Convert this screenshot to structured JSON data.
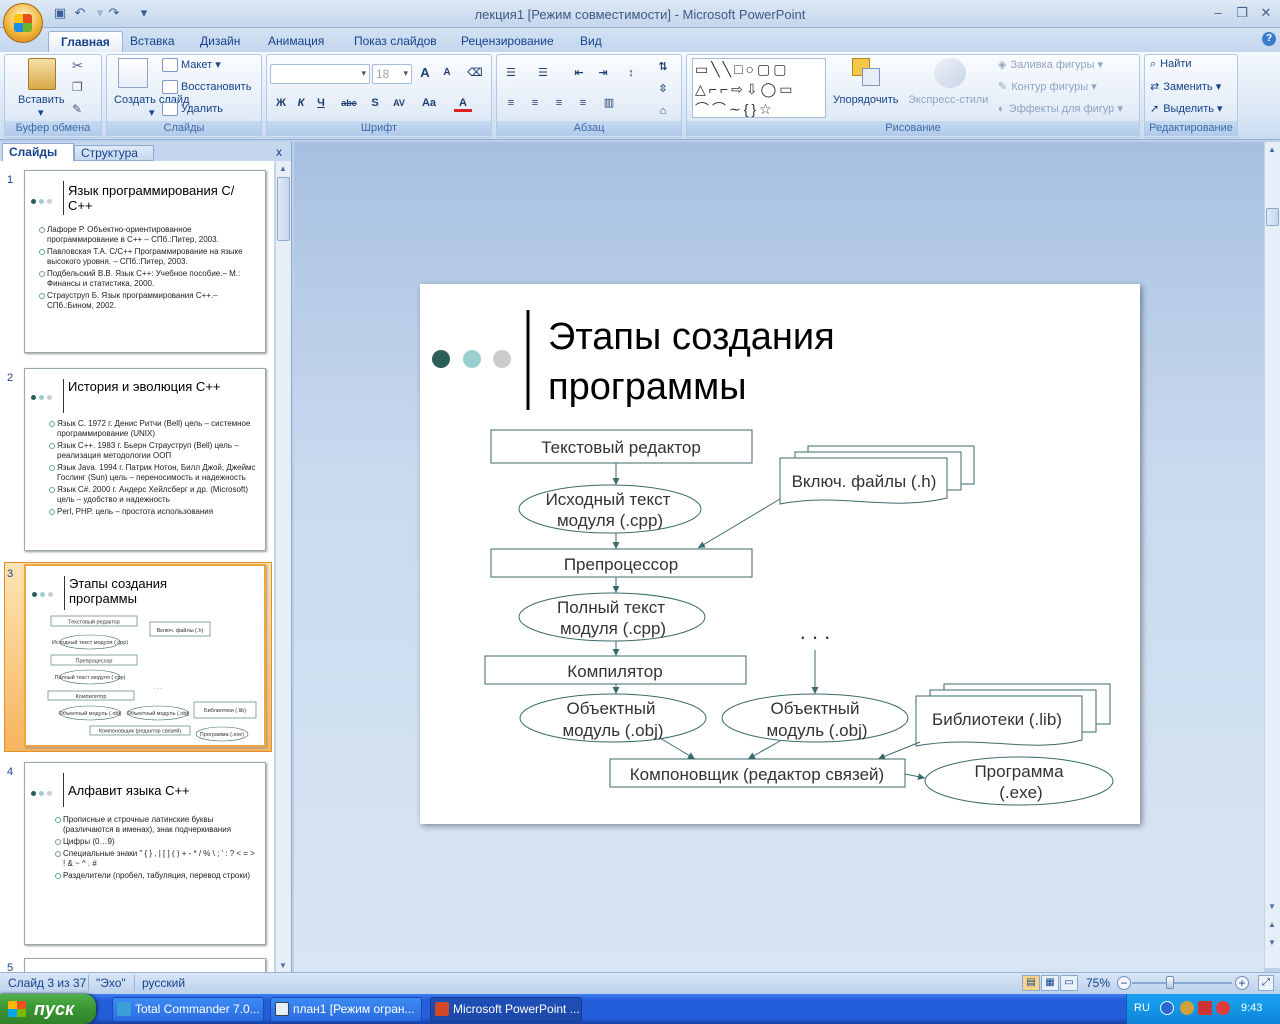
{
  "window": {
    "title": "лекция1 [Режим совместимости] - Microsoft PowerPoint",
    "minimize": "–",
    "maximize": "❐",
    "close": "✕"
  },
  "ribbon": {
    "tabs": [
      "Главная",
      "Вставка",
      "Дизайн",
      "Анимация",
      "Показ слайдов",
      "Рецензирование",
      "Вид"
    ],
    "active_tab": "Главная",
    "clipboard": {
      "paste": "Вставить",
      "label": "Буфер обмена"
    },
    "slides": {
      "new_slide": "Создать слайд",
      "new_slide_arrow": "▾",
      "layout": "Макет",
      "reset": "Восстановить",
      "delete": "Удалить",
      "label": "Слайды"
    },
    "font": {
      "font_name": "",
      "font_size": "18",
      "label": "Шрифт"
    },
    "paragraph": {
      "label": "Абзац"
    },
    "drawing": {
      "arrange": "Упорядочить",
      "quick_styles": "Экспресс-стили",
      "shape_fill": "Заливка фигуры",
      "shape_outline": "Контур фигуры",
      "shape_effects": "Эффекты для фигур",
      "label": "Рисование"
    },
    "editing": {
      "find": "Найти",
      "replace": "Заменить",
      "select": "Выделить",
      "label": "Редактирование"
    }
  },
  "left_pane": {
    "tab_slides": "Слайды",
    "tab_outline": "Структура",
    "close": "x",
    "slides": [
      {
        "num": "1",
        "title": "Язык программирования С/С++",
        "bullets": [
          "Лафоре Р. Объектно-ориентированное программирование в С++ – СПб.:Питер, 2003.",
          "Павловская Т.А. С/С++ Программирование на языке высокого уровня. – СПб.:Питер, 2003.",
          "Подбельский В.В. Язык С++: Учебное пособие.– М.: Финансы и статистика, 2000.",
          "Страуструп Б. Язык программирования С++.– СПб.:Бином, 2002."
        ]
      },
      {
        "num": "2",
        "title": "История и эволюция С++",
        "bullets": [
          "Язык С. 1972 г. Денис Ритчи (Bell) цель – системное программирование (UNIX)",
          "Язык С++. 1983 г. Бьерн Страуструп (Bell) цель – реализация методологии ООП",
          "Язык Java. 1994 г. Патрик Нотон, Билл Джой, Джеймс Гослинг (Sun) цель – переносимость и надежность",
          "Язык C#. 2000 г. Андерс Хейлсберг и др. (Microsoft) цель – удобство и надежность",
          "Perl, PHP. цель – простота использования"
        ]
      },
      {
        "num": "3",
        "title": "Этапы создания программы"
      },
      {
        "num": "4",
        "title": "Алфавит языка С++",
        "bullets": [
          "Прописные и строчные латинские буквы (различаются в именах), знак подчеркивания",
          "Цифры (0…9)",
          "Специальные знаки \" { } , | [ ] ( ) + - * / % \\ ; ' : ? < = > ! & ~ ^ . #",
          "Разделители (пробел, табуляция, перевод строки)"
        ]
      },
      {
        "num": "5"
      }
    ]
  },
  "slide": {
    "title": "Этапы создания\nпрограммы",
    "nodes": {
      "editor": "Текстовый редактор",
      "source_1": "Исходный текст",
      "source_2": "модуля (.cpp)",
      "include": "Включ. файлы (.h)",
      "preprocessor": "Препроцессор",
      "full_1": "Полный текст",
      "full_2": "модуля (.cpp)",
      "compiler": "Компилятор",
      "dots": ". . .",
      "obj_1a": "Объектный",
      "obj_1b": "модуль (.obj)",
      "obj_2a": "Объектный",
      "obj_2b": "модуль (.obj)",
      "libs": "Библиотеки (.lib)",
      "linker": "Компоновщик (редактор связей)",
      "program_1": "Программа",
      "program_2": "(.exe)"
    },
    "thumb_nodes": {
      "editor": "Текстовый редактор",
      "source": "Исходный текст модуля (.cpp)",
      "include": "Включ. файлы (.h)",
      "preprocessor": "Препроцессор",
      "full": "Полный текст модуля (.cpp)",
      "compiler": "Компилятор",
      "dots": ". . .",
      "obj": "Объектный модуль (.obj)",
      "libs": "Библиотеки (.lib)",
      "linker": "Компоновщик (редактор связей)",
      "program": "Программа (.exe)"
    },
    "dot_colors": [
      "#2e5e58",
      "#9ccfd0",
      "#cccccc"
    ]
  },
  "status": {
    "slide_of": "Слайд 3 из 37",
    "theme": "\"Эхо\"",
    "language": "русский",
    "zoom": "75%"
  },
  "taskbar": {
    "start": "пуск",
    "tasks": [
      "Total Commander 7.0...",
      "план1 [Режим огран...",
      "Microsoft PowerPoint ..."
    ],
    "lang": "RU",
    "time": "9:43"
  }
}
